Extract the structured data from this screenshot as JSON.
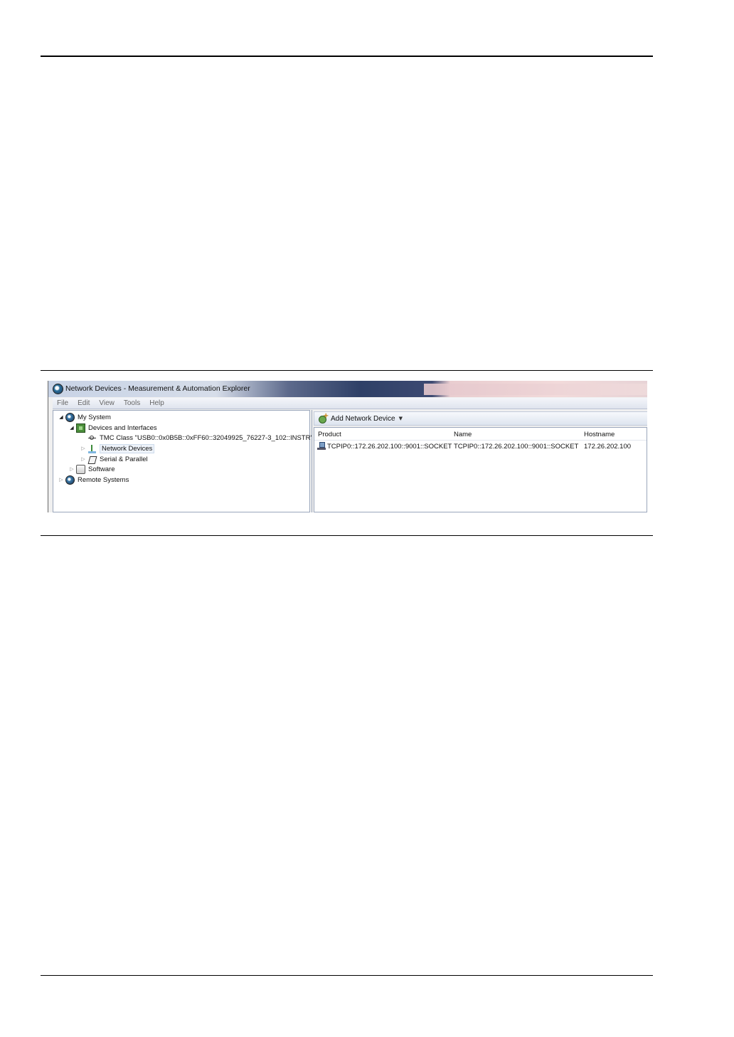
{
  "window": {
    "title": "Network Devices - Measurement & Automation Explorer"
  },
  "menu": [
    "File",
    "Edit",
    "View",
    "Tools",
    "Help"
  ],
  "tree": {
    "my_system": "My System",
    "devices_and_interfaces": "Devices and Interfaces",
    "tmc_class": "TMC Class \"USB0::0x0B5B::0xFF60::32049925_76227-3_102::INSTR\"",
    "network_devices": "Network Devices",
    "serial_parallel": "Serial & Parallel",
    "software": "Software",
    "remote_systems": "Remote Systems"
  },
  "toolbar": {
    "add_network_device": "Add Network Device"
  },
  "table": {
    "columns": [
      "Product",
      "Name",
      "Hostname"
    ],
    "rows": [
      {
        "product": "TCPIP0::172.26.202.100::9001::SOCKET",
        "name": "TCPIP0::172.26.202.100::9001::SOCKET",
        "hostname": "172.26.202.100"
      }
    ]
  },
  "icons": [
    "globe-icon",
    "chip-icon",
    "usb-icon",
    "network-icon",
    "serial-icon",
    "software-icon",
    "add-device-icon",
    "network-device-icon"
  ]
}
